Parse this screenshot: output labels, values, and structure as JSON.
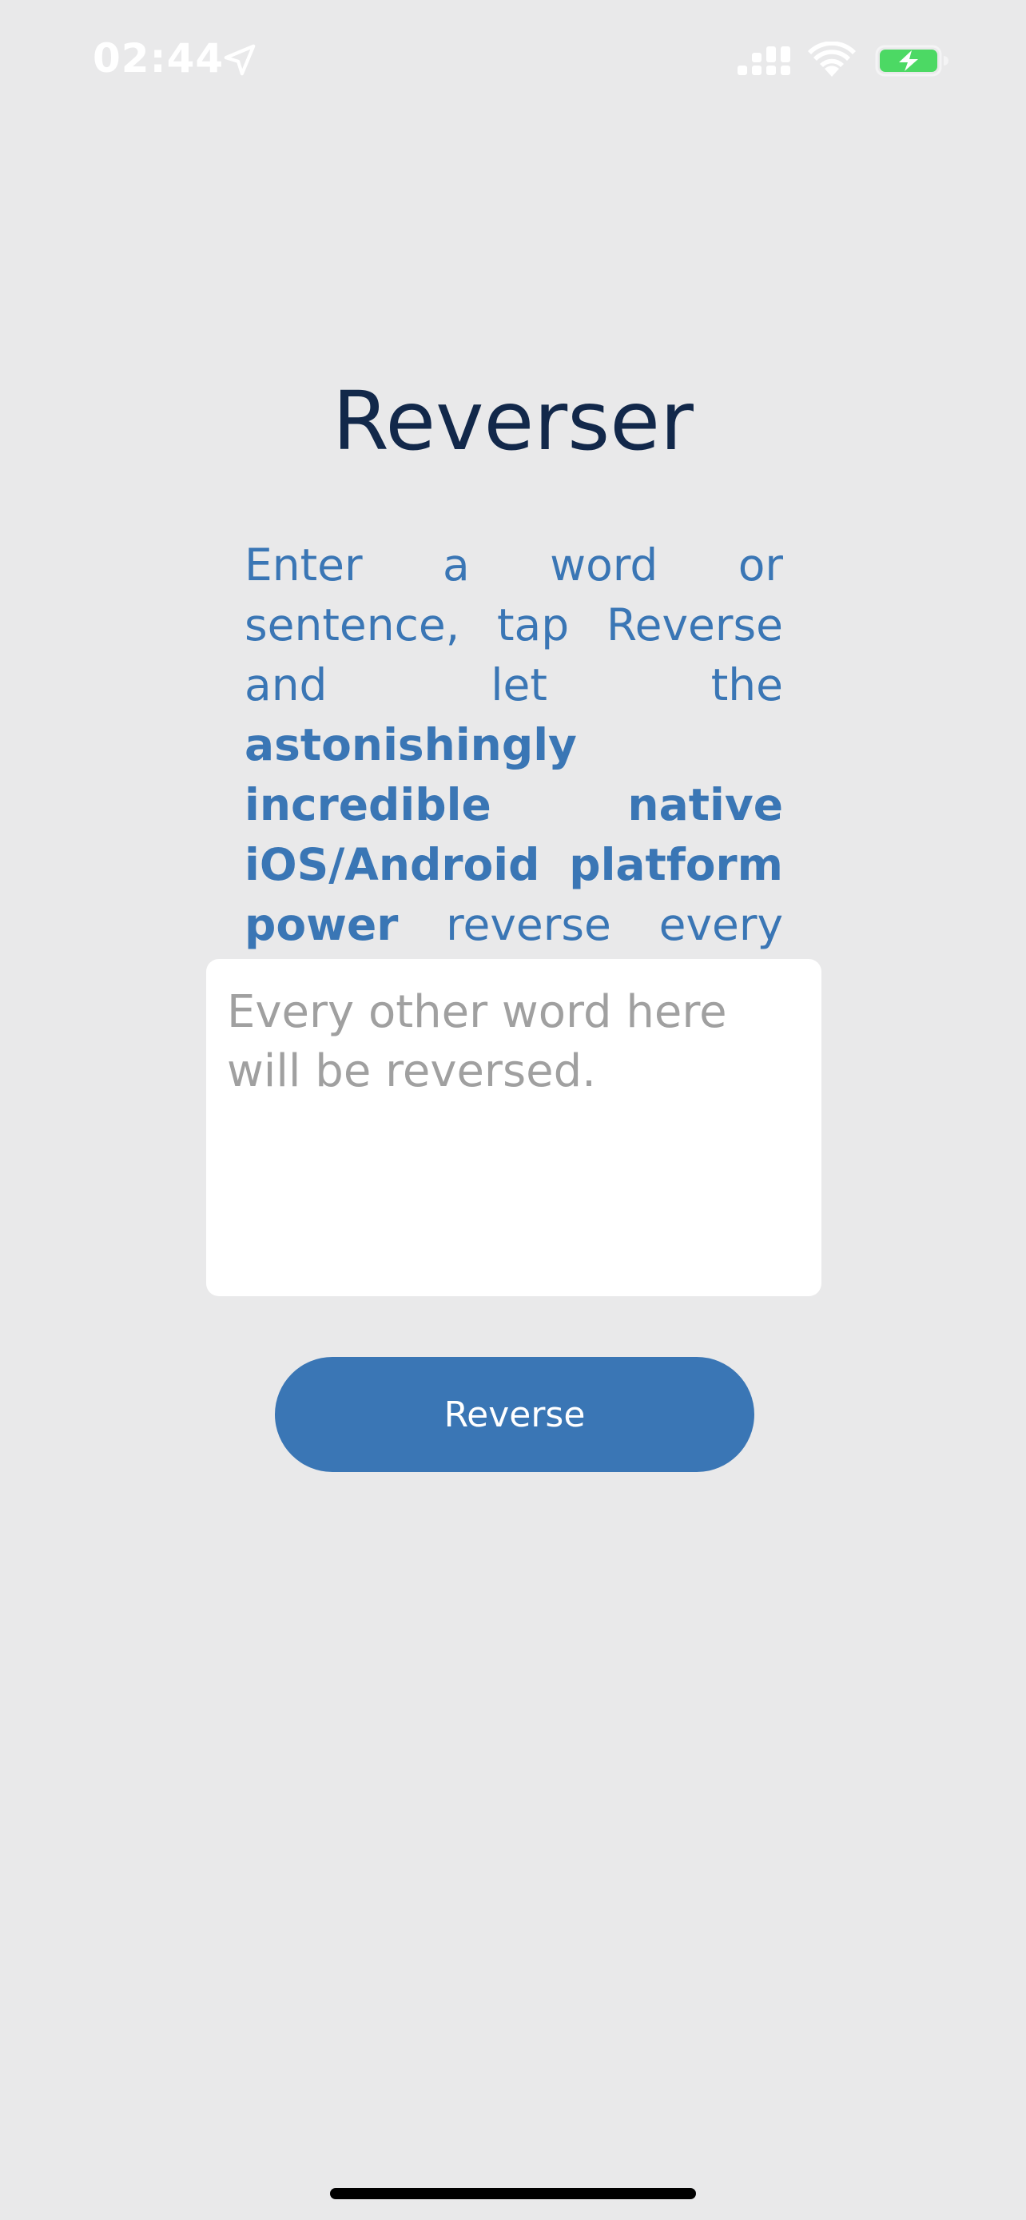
{
  "status_bar": {
    "time": "02:44",
    "icons": [
      "location-arrow-icon",
      "cellular-signal-icon",
      "wifi-icon",
      "battery-charging-icon"
    ],
    "battery_color": "#4cd964"
  },
  "app": {
    "title": "Reverser",
    "description": {
      "part1": "Enter a word or sentence, tap Reverse and let the ",
      "bold": "astonishingly incredible native iOS/Android platform power",
      "part2": " reverse every other word of it."
    },
    "input": {
      "value": "",
      "placeholder": "Every other word here will be reversed."
    },
    "reverse_button_label": "Reverse"
  },
  "colors": {
    "background": "#e9e9ea",
    "title": "#12284a",
    "accent": "#3a76b5"
  }
}
